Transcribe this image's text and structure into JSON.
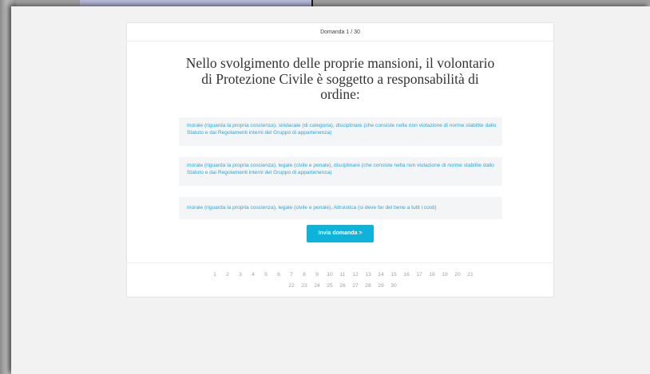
{
  "header": {
    "question_counter": "Domanda 1 / 30"
  },
  "question": {
    "text": "Nello svolgimento delle proprie mansioni, il volontario di Protezione Civile è soggetto a responsabilità di ordine:"
  },
  "answers": [
    {
      "text": "morale (riguarda la propria coscienza), sindacale (di categoria), disciplinare (che consiste nella non violazione di norme stabilite dallo Statuto e dai Regolamenti interni del Gruppo di appartenenza)"
    },
    {
      "text": "morale (riguarda la propria coscienza), legale (civile e penale), disciplinare (che consiste nella non violazione di norme stabilite dallo Statuto e dai Regolamenti interni del Gruppo di appartenenza)"
    },
    {
      "text": "morale (riguarda la propria coscienza), legale (civile e penale), Altruistica (si deve far del bene a tutti i costi)"
    }
  ],
  "submit": {
    "label": "Invia domanda >"
  },
  "colors": {
    "accent": "#0fb3da",
    "answer_text": "#2aa7d6",
    "answer_bg": "#f4f5f7"
  },
  "pagination": {
    "row1": [
      "1",
      "2",
      "3",
      "4",
      "5",
      "6",
      "7",
      "8",
      "9",
      "10",
      "11",
      "12",
      "13",
      "14",
      "15",
      "16",
      "17",
      "18",
      "19",
      "20",
      "21"
    ],
    "row2": [
      "22",
      "23",
      "24",
      "25",
      "26",
      "27",
      "28",
      "29",
      "30"
    ]
  }
}
